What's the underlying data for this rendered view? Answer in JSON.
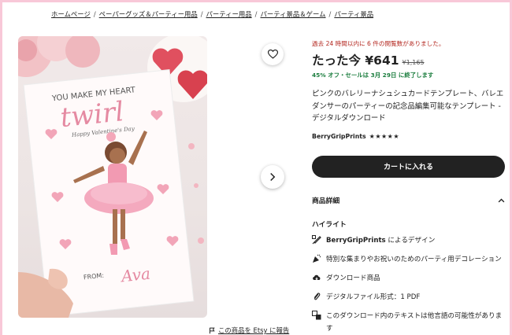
{
  "breadcrumb": {
    "items": [
      "ホームページ",
      "ペーパーグッズ＆パーティー用品",
      "パーティー用品",
      "パーティ景品＆ゲーム",
      "パーティ景品"
    ],
    "separator": "/"
  },
  "product_image": {
    "card_header": "YOU MAKE MY HEART",
    "card_script": "twirl",
    "card_sub": "Happy Valentine's Day",
    "card_from_label": "FROM:",
    "card_from_name": "Ava"
  },
  "actions": {
    "favorite_icon": "heart-outline-icon",
    "next_icon": "chevron-right-icon"
  },
  "report": {
    "label": "この商品を Etsy に報告",
    "icon": "flag-icon"
  },
  "listing": {
    "views_notice": "過去 24 時間以内に 6 件の閲覧数がありました。",
    "price_prefix": "たった今 ¥641",
    "price_old": "¥1,165",
    "sale_note": "45% オフ・セールは 3月 29日 に終了します",
    "title": "ピンクのバレリーナシュシュカードテンプレート、バレエダンサーのパーティーの記念品編集可能なテンプレート - デジタルダウンロード",
    "seller": "BerryGripPrints",
    "stars": "★★★★★",
    "cart_button": "カートに入れる"
  },
  "details": {
    "header": "商品詳細",
    "highlights_label": "ハイライト",
    "highlights": [
      {
        "icon": "brush-icon",
        "bold": "BerryGripPrints",
        "rest": " によるデザイン"
      },
      {
        "icon": "party-popper-icon",
        "bold": "",
        "rest": "特別な集まりやお祝いのためのパーティ用デコレーション"
      },
      {
        "icon": "cloud-download-icon",
        "bold": "",
        "rest": "ダウンロード商品"
      },
      {
        "icon": "paperclip-icon",
        "bold": "",
        "rest": "デジタルファイル形式：1 PDF"
      },
      {
        "icon": "translate-icon",
        "bold": "",
        "rest": "このダウンロード内のテキストは他言語の可能性があります"
      }
    ]
  },
  "colors": {
    "border_pink": "#f8c8d8",
    "sale_green": "#1c7e3f",
    "notice_red": "#b3261e",
    "button_black": "#222222"
  }
}
